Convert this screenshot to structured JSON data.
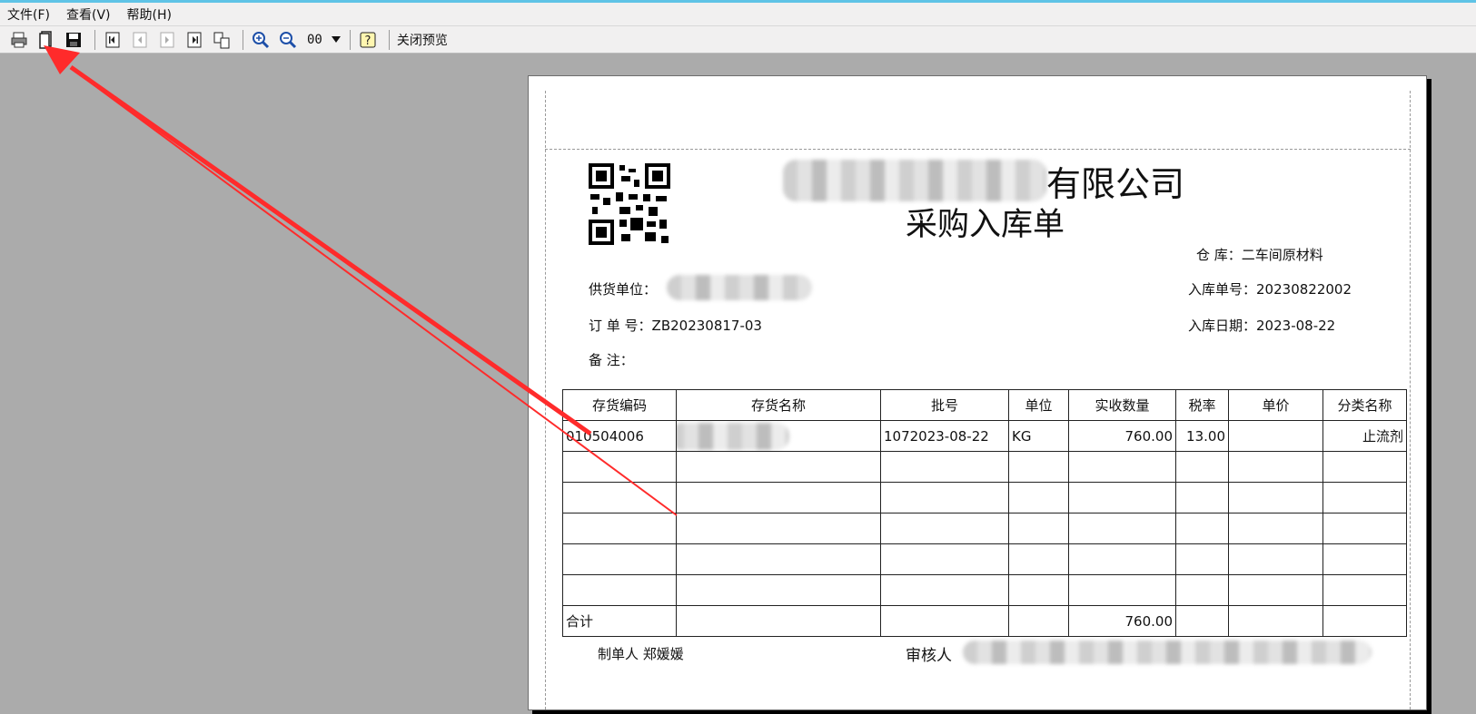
{
  "menu": {
    "file": "文件(F)",
    "view": "查看(V)",
    "help": "帮助(H)"
  },
  "toolbar": {
    "icons": [
      "printer-icon",
      "page-setup-icon",
      "save-icon",
      "first-page-icon",
      "prev-page-icon",
      "next-page-icon",
      "last-page-icon",
      "multi-page-icon",
      "zoom-in-icon",
      "zoom-out-icon",
      "help-icon"
    ],
    "zoom_value": "00",
    "close_preview_label": "关闭预览"
  },
  "document": {
    "company_suffix": "有限公司",
    "title": "采购入库单",
    "warehouse_label": "仓    库：",
    "warehouse_value": "二车间原材料",
    "supplier_label": "供货单位：",
    "receipt_no_label": "入库单号：",
    "receipt_no_value": "20230822002",
    "order_no_label": "订 单 号：",
    "order_no_value": "ZB20230817-03",
    "date_label": "入库日期：",
    "date_value": "2023-08-22",
    "remark_label": "备    注：",
    "table": {
      "headers": [
        "存货编码",
        "存货名称",
        "批号",
        "单位",
        "实收数量",
        "税率",
        "单价",
        "分类名称"
      ],
      "row": {
        "code": "010504006",
        "batch": "1072023-08-22",
        "unit": "KG",
        "qty": "760.00",
        "tax": "13.00",
        "price": "",
        "category": "止流剂"
      },
      "total_label": "合计",
      "total_qty": "760.00"
    },
    "maker_label": "制单人",
    "maker_value": "郑媛媛",
    "reviewer_label": "审核人"
  },
  "colors": {
    "annotation_arrow": "#ff2b2b",
    "preview_background": "#ababab",
    "accent_line": "#5fc3e6"
  }
}
